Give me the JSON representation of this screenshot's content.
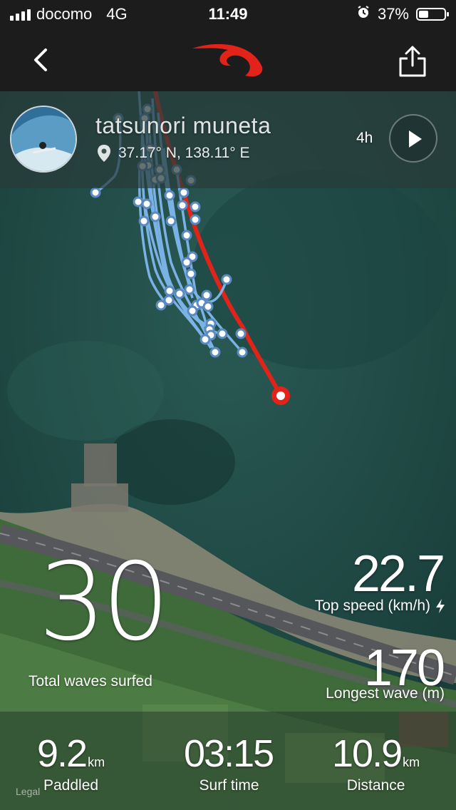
{
  "status_bar": {
    "carrier": "docomo",
    "network": "4G",
    "time": "11:49",
    "battery_percent": "37%",
    "battery_level": 0.37
  },
  "profile": {
    "name": "tatsunori muneta",
    "location": "37.17° N, 138.11° E",
    "duration": "4h"
  },
  "stats": {
    "total_waves": "30",
    "total_waves_label": "Total waves surfed",
    "top_speed": "22.7",
    "top_speed_label": "Top speed (km/h)",
    "longest_wave": "170",
    "longest_wave_label": "Longest wave (m)"
  },
  "bottom_stats": [
    {
      "value": "9.2",
      "unit": "km",
      "label": "Paddled"
    },
    {
      "value": "03:15",
      "unit": "",
      "label": "Surf time"
    },
    {
      "value": "10.9",
      "unit": "km",
      "label": "Distance"
    }
  ],
  "legal": "Legal",
  "colors": {
    "brand_red": "#e2231a",
    "wave_track": "#7fb8ee",
    "bar_bg": "#1c1c1c"
  },
  "icons": {
    "back": "chevron-left-icon",
    "logo": "ripcurl-logo",
    "share": "share-icon",
    "location": "location-pin-icon",
    "play": "play-icon",
    "lightning": "lightning-icon"
  }
}
